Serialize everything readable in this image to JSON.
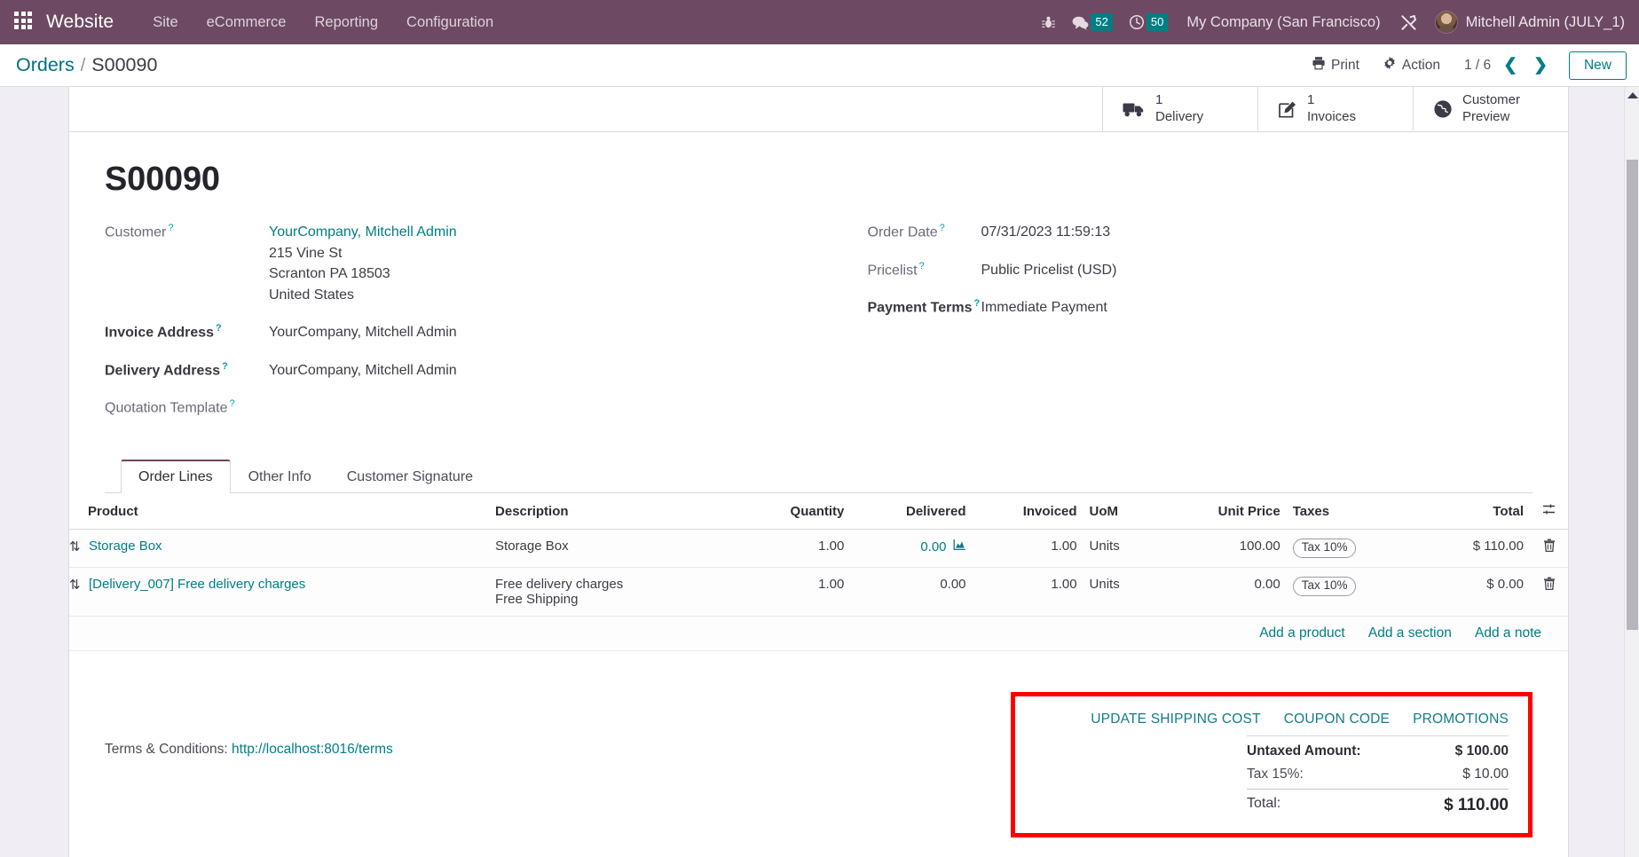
{
  "navbar": {
    "apps_icon": "apps-grid-icon",
    "brand": "Website",
    "menu": [
      "Site",
      "eCommerce",
      "Reporting",
      "Configuration"
    ],
    "icons": [
      {
        "name": "bug-icon",
        "label": "Debug"
      },
      {
        "name": "messages-icon",
        "label": "Messages",
        "count": "52"
      },
      {
        "name": "activities-clock-icon",
        "label": "Activities",
        "count": "50"
      }
    ],
    "company": "My Company (San Francisco)",
    "tools_icon": "wrench-screwdriver-icon",
    "user": "Mitchell Admin (JULY_1)"
  },
  "control_panel": {
    "breadcrumb_root": "Orders",
    "breadcrumb_sep": "/",
    "breadcrumb_current": "S00090",
    "print_label": "Print",
    "print_icon": "printer-icon",
    "action_label": "Action",
    "action_icon": "gear-icon",
    "pager": "1 / 6",
    "prev_icon": "chevron-left-icon",
    "next_icon": "chevron-right-icon",
    "new_label": "New"
  },
  "smart_buttons": [
    {
      "icon": "truck-icon",
      "value": "1",
      "label": "Delivery"
    },
    {
      "icon": "pencil-square-icon",
      "value": "1",
      "label": "Invoices"
    },
    {
      "icon": "globe-icon",
      "value": "Customer",
      "label": "Preview"
    }
  ],
  "form": {
    "title": "S00090",
    "left_fields": [
      {
        "label": "Customer",
        "bold": false,
        "help": "?",
        "link": "YourCompany, Mitchell Admin",
        "lines": [
          "215 Vine St",
          "Scranton PA 18503",
          "United States"
        ]
      },
      {
        "label": "Invoice Address",
        "bold": true,
        "help": "?",
        "value": "YourCompany, Mitchell Admin"
      },
      {
        "label": "Delivery Address",
        "bold": true,
        "help": "?",
        "value": "YourCompany, Mitchell Admin"
      },
      {
        "label": "Quotation Template",
        "bold": false,
        "help": "?",
        "value": ""
      }
    ],
    "right_fields": [
      {
        "label": "Order Date",
        "bold": false,
        "help": "?",
        "value": "07/31/2023 11:59:13"
      },
      {
        "label": "Pricelist",
        "bold": false,
        "help": "?",
        "value": "Public Pricelist (USD)"
      },
      {
        "label": "Payment Terms",
        "bold": true,
        "help": "?",
        "value": "Immediate Payment"
      }
    ]
  },
  "notebook": {
    "tabs": [
      {
        "label": "Order Lines",
        "active": true
      },
      {
        "label": "Other Info",
        "active": false
      },
      {
        "label": "Customer Signature",
        "active": false
      }
    ]
  },
  "lines_table": {
    "columns": [
      "Product",
      "Description",
      "Quantity",
      "Delivered",
      "Invoiced",
      "UoM",
      "Unit Price",
      "Taxes",
      "Total"
    ],
    "options_icon": "column-options-icon",
    "rows": [
      {
        "handle_icon": "drag-handle-icon",
        "product": "Storage Box",
        "description": "Storage Box",
        "description_sub": "",
        "quantity": "1.00",
        "delivered": "0.00",
        "delivered_icon": "area-chart-icon",
        "invoiced": "1.00",
        "uom": "Units",
        "unit_price": "100.00",
        "taxes": "Tax 10%",
        "total": "$ 110.00",
        "delete_icon": "trash-icon"
      },
      {
        "handle_icon": "drag-handle-icon",
        "product": "[Delivery_007] Free delivery charges",
        "description": "Free delivery charges",
        "description_sub": "Free Shipping",
        "quantity": "1.00",
        "delivered": "0.00",
        "delivered_icon": "",
        "invoiced": "1.00",
        "uom": "Units",
        "unit_price": "0.00",
        "taxes": "Tax 10%",
        "total": "$ 0.00",
        "delete_icon": "trash-icon"
      }
    ],
    "add_links": [
      "Add a product",
      "Add a section",
      "Add a note"
    ]
  },
  "footer": {
    "terms_label": "Terms & Conditions:",
    "terms_url": "http://localhost:8016/terms",
    "promo_links": [
      "UPDATE SHIPPING COST",
      "COUPON CODE",
      "PROMOTIONS"
    ],
    "totals": [
      {
        "label": "Untaxed Amount:",
        "value": "$ 100.00",
        "style": "untaxed"
      },
      {
        "label": "Tax 15%:",
        "value": "$ 10.00",
        "style": "tax"
      },
      {
        "label": "Total:",
        "value": "$ 110.00",
        "style": "grand"
      }
    ],
    "highlight_color": "#fe0000"
  },
  "colors": {
    "navbar_bg": "#6d4963",
    "accent": "#017e84",
    "badge_bg": "#017e84",
    "page_bg": "#f0eef4",
    "highlight": "#fe0000"
  }
}
